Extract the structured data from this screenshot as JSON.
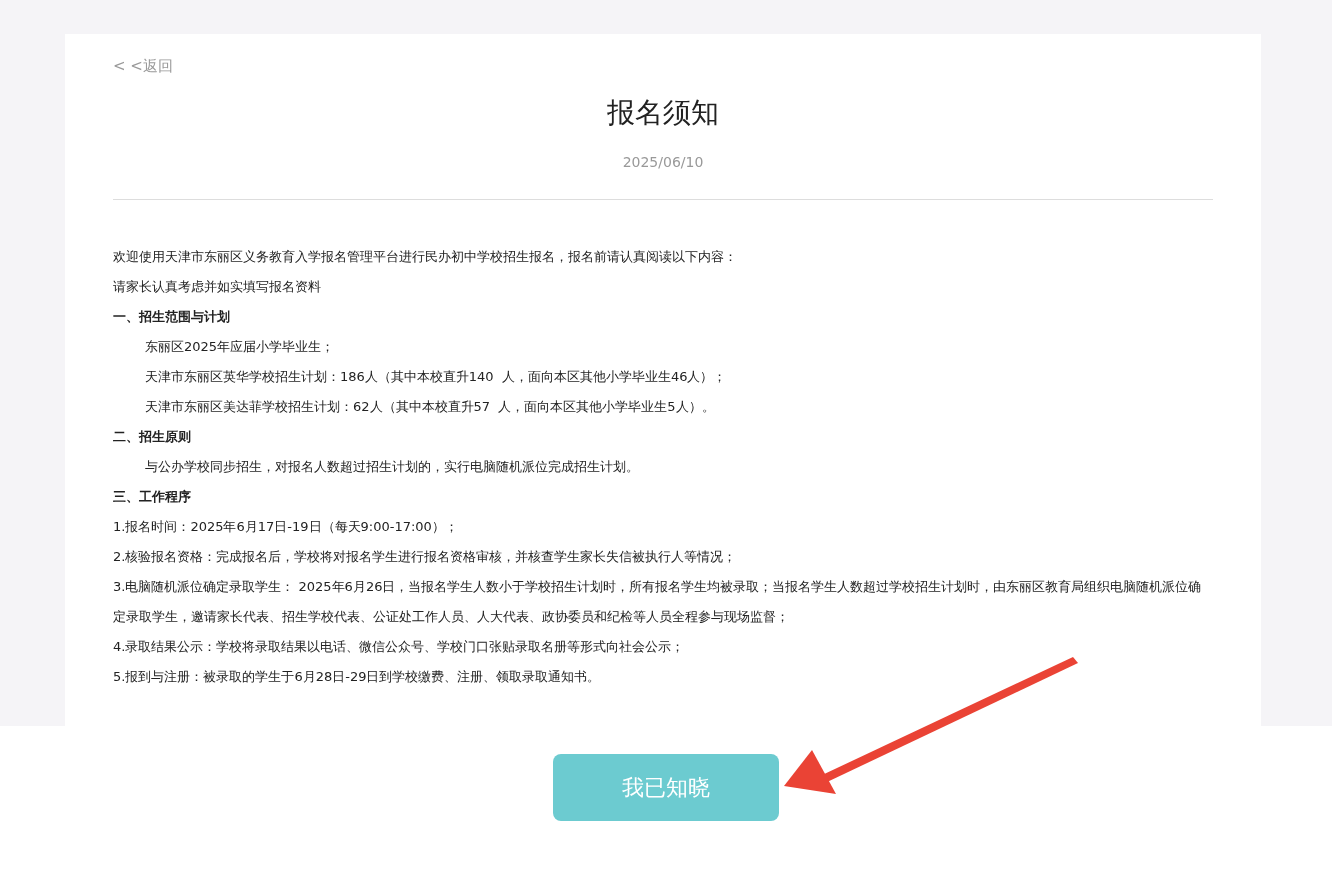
{
  "back_link": "< <返回",
  "title": "报名须知",
  "date": "2025/06/10",
  "paragraphs": [
    {
      "kind": "text",
      "text": "欢迎使用天津市东丽区义务教育入学报名管理平台进行民办初中学校招生报名，报名前请认真阅读以下内容："
    },
    {
      "kind": "text",
      "text": "请家长认真考虑并如实填写报名资料"
    },
    {
      "kind": "heading",
      "text": "一、招生范围与计划"
    },
    {
      "kind": "indent",
      "text": "东丽区2025年应届小学毕业生；"
    },
    {
      "kind": "indent",
      "text": "天津市东丽区英华学校招生计划：186人（其中本校直升140  人，面向本区其他小学毕业生46人）；"
    },
    {
      "kind": "indent",
      "text": "天津市东丽区美达菲学校招生计划：62人（其中本校直升57  人，面向本区其他小学毕业生5人）。"
    },
    {
      "kind": "heading",
      "text": "二、招生原则"
    },
    {
      "kind": "indent",
      "text": "与公办学校同步招生，对报名人数超过招生计划的，实行电脑随机派位完成招生计划。"
    },
    {
      "kind": "heading",
      "text": "三、工作程序"
    },
    {
      "kind": "text",
      "text": "1.报名时间：2025年6月17日-19日（每天9:00-17:00）；"
    },
    {
      "kind": "text",
      "text": "2.核验报名资格：完成报名后，学校将对报名学生进行报名资格审核，并核查学生家长失信被执行人等情况；"
    },
    {
      "kind": "text",
      "text": "3.电脑随机派位确定录取学生： 2025年6月26日，当报名学生人数小于学校招生计划时，所有报名学生均被录取；当报名学生人数超过学校招生计划时，由东丽区教育局组织电脑随机派位确定录取学生，邀请家长代表、招生学校代表、公证处工作人员、人大代表、政协委员和纪检等人员全程参与现场监督；"
    },
    {
      "kind": "text",
      "text": "4.录取结果公示：学校将录取结果以电话、微信公众号、学校门口张贴录取名册等形式向社会公示；"
    },
    {
      "kind": "text",
      "text": "5.报到与注册：被录取的学生于6月28日-29日到学校缴费、注册、领取录取通知书。"
    }
  ],
  "confirm_button": "我已知晓"
}
